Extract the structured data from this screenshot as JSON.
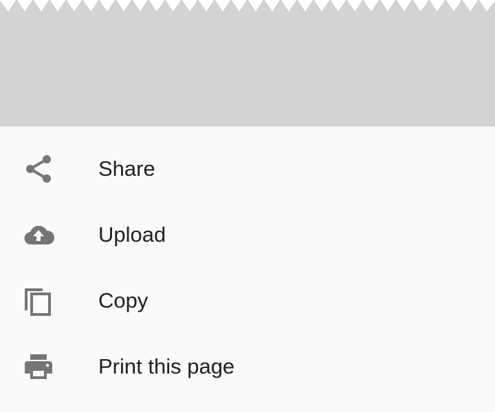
{
  "bottom_sheet": {
    "items": [
      {
        "label": "Share",
        "icon": "share-icon"
      },
      {
        "label": "Upload",
        "icon": "cloud-upload-icon"
      },
      {
        "label": "Copy",
        "icon": "copy-icon"
      },
      {
        "label": "Print this page",
        "icon": "print-icon"
      }
    ]
  },
  "colors": {
    "scrim": "#d3d3d3",
    "sheet_background": "#fafafa",
    "icon": "#757575",
    "text": "#212121"
  }
}
